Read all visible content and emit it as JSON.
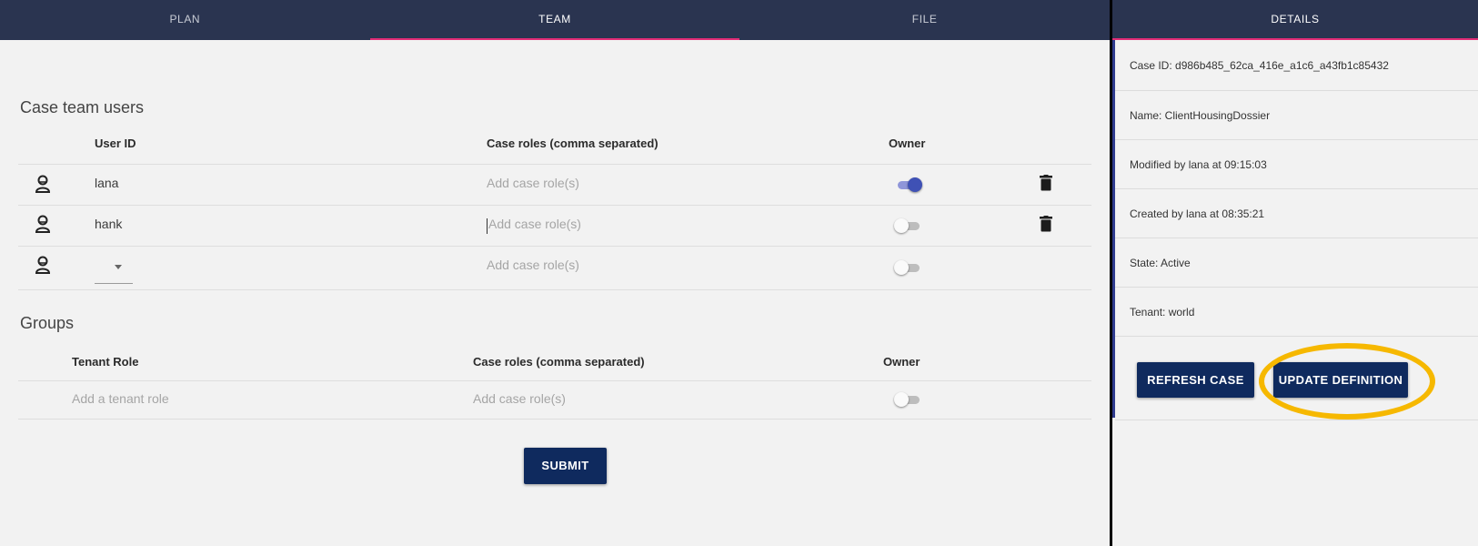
{
  "tabs": [
    "PLAN",
    "TEAM",
    "FILE"
  ],
  "active_tab": "TEAM",
  "details_tab": "DETAILS",
  "users_section": {
    "title": "Case team users",
    "headers": {
      "user_id": "User ID",
      "roles": "Case roles (comma separated)",
      "owner": "Owner"
    },
    "rows": [
      {
        "user": "lana",
        "roles_placeholder": "Add case role(s)",
        "owner": true
      },
      {
        "user": "hank",
        "roles_placeholder": "Add case role(s)",
        "owner": false
      },
      {
        "user": "",
        "roles_placeholder": "Add case role(s)",
        "owner": false
      }
    ]
  },
  "groups_section": {
    "title": "Groups",
    "headers": {
      "tenant_role": "Tenant Role",
      "roles": "Case roles (comma separated)",
      "owner": "Owner"
    },
    "rows": [
      {
        "tenant_role_placeholder": "Add a tenant role",
        "roles_placeholder": "Add case role(s)",
        "owner": false
      }
    ]
  },
  "submit_label": "SUBMIT",
  "details": {
    "case_id": "Case ID: d986b485_62ca_416e_a1c6_a43fb1c85432",
    "name": "Name: ClientHousingDossier",
    "modified": "Modified by lana at 09:15:03",
    "created": "Created by lana at 08:35:21",
    "state": "State: Active",
    "tenant": "Tenant: world",
    "refresh_label": "REFRESH CASE",
    "update_label": "UPDATE DEFINITION"
  },
  "colors": {
    "header_bg": "#2a3450",
    "tab_indicator": "#e22d77",
    "button_bg": "#0f2a5e",
    "toggle_on": "#3f51b5",
    "highlight": "#f6b800"
  }
}
